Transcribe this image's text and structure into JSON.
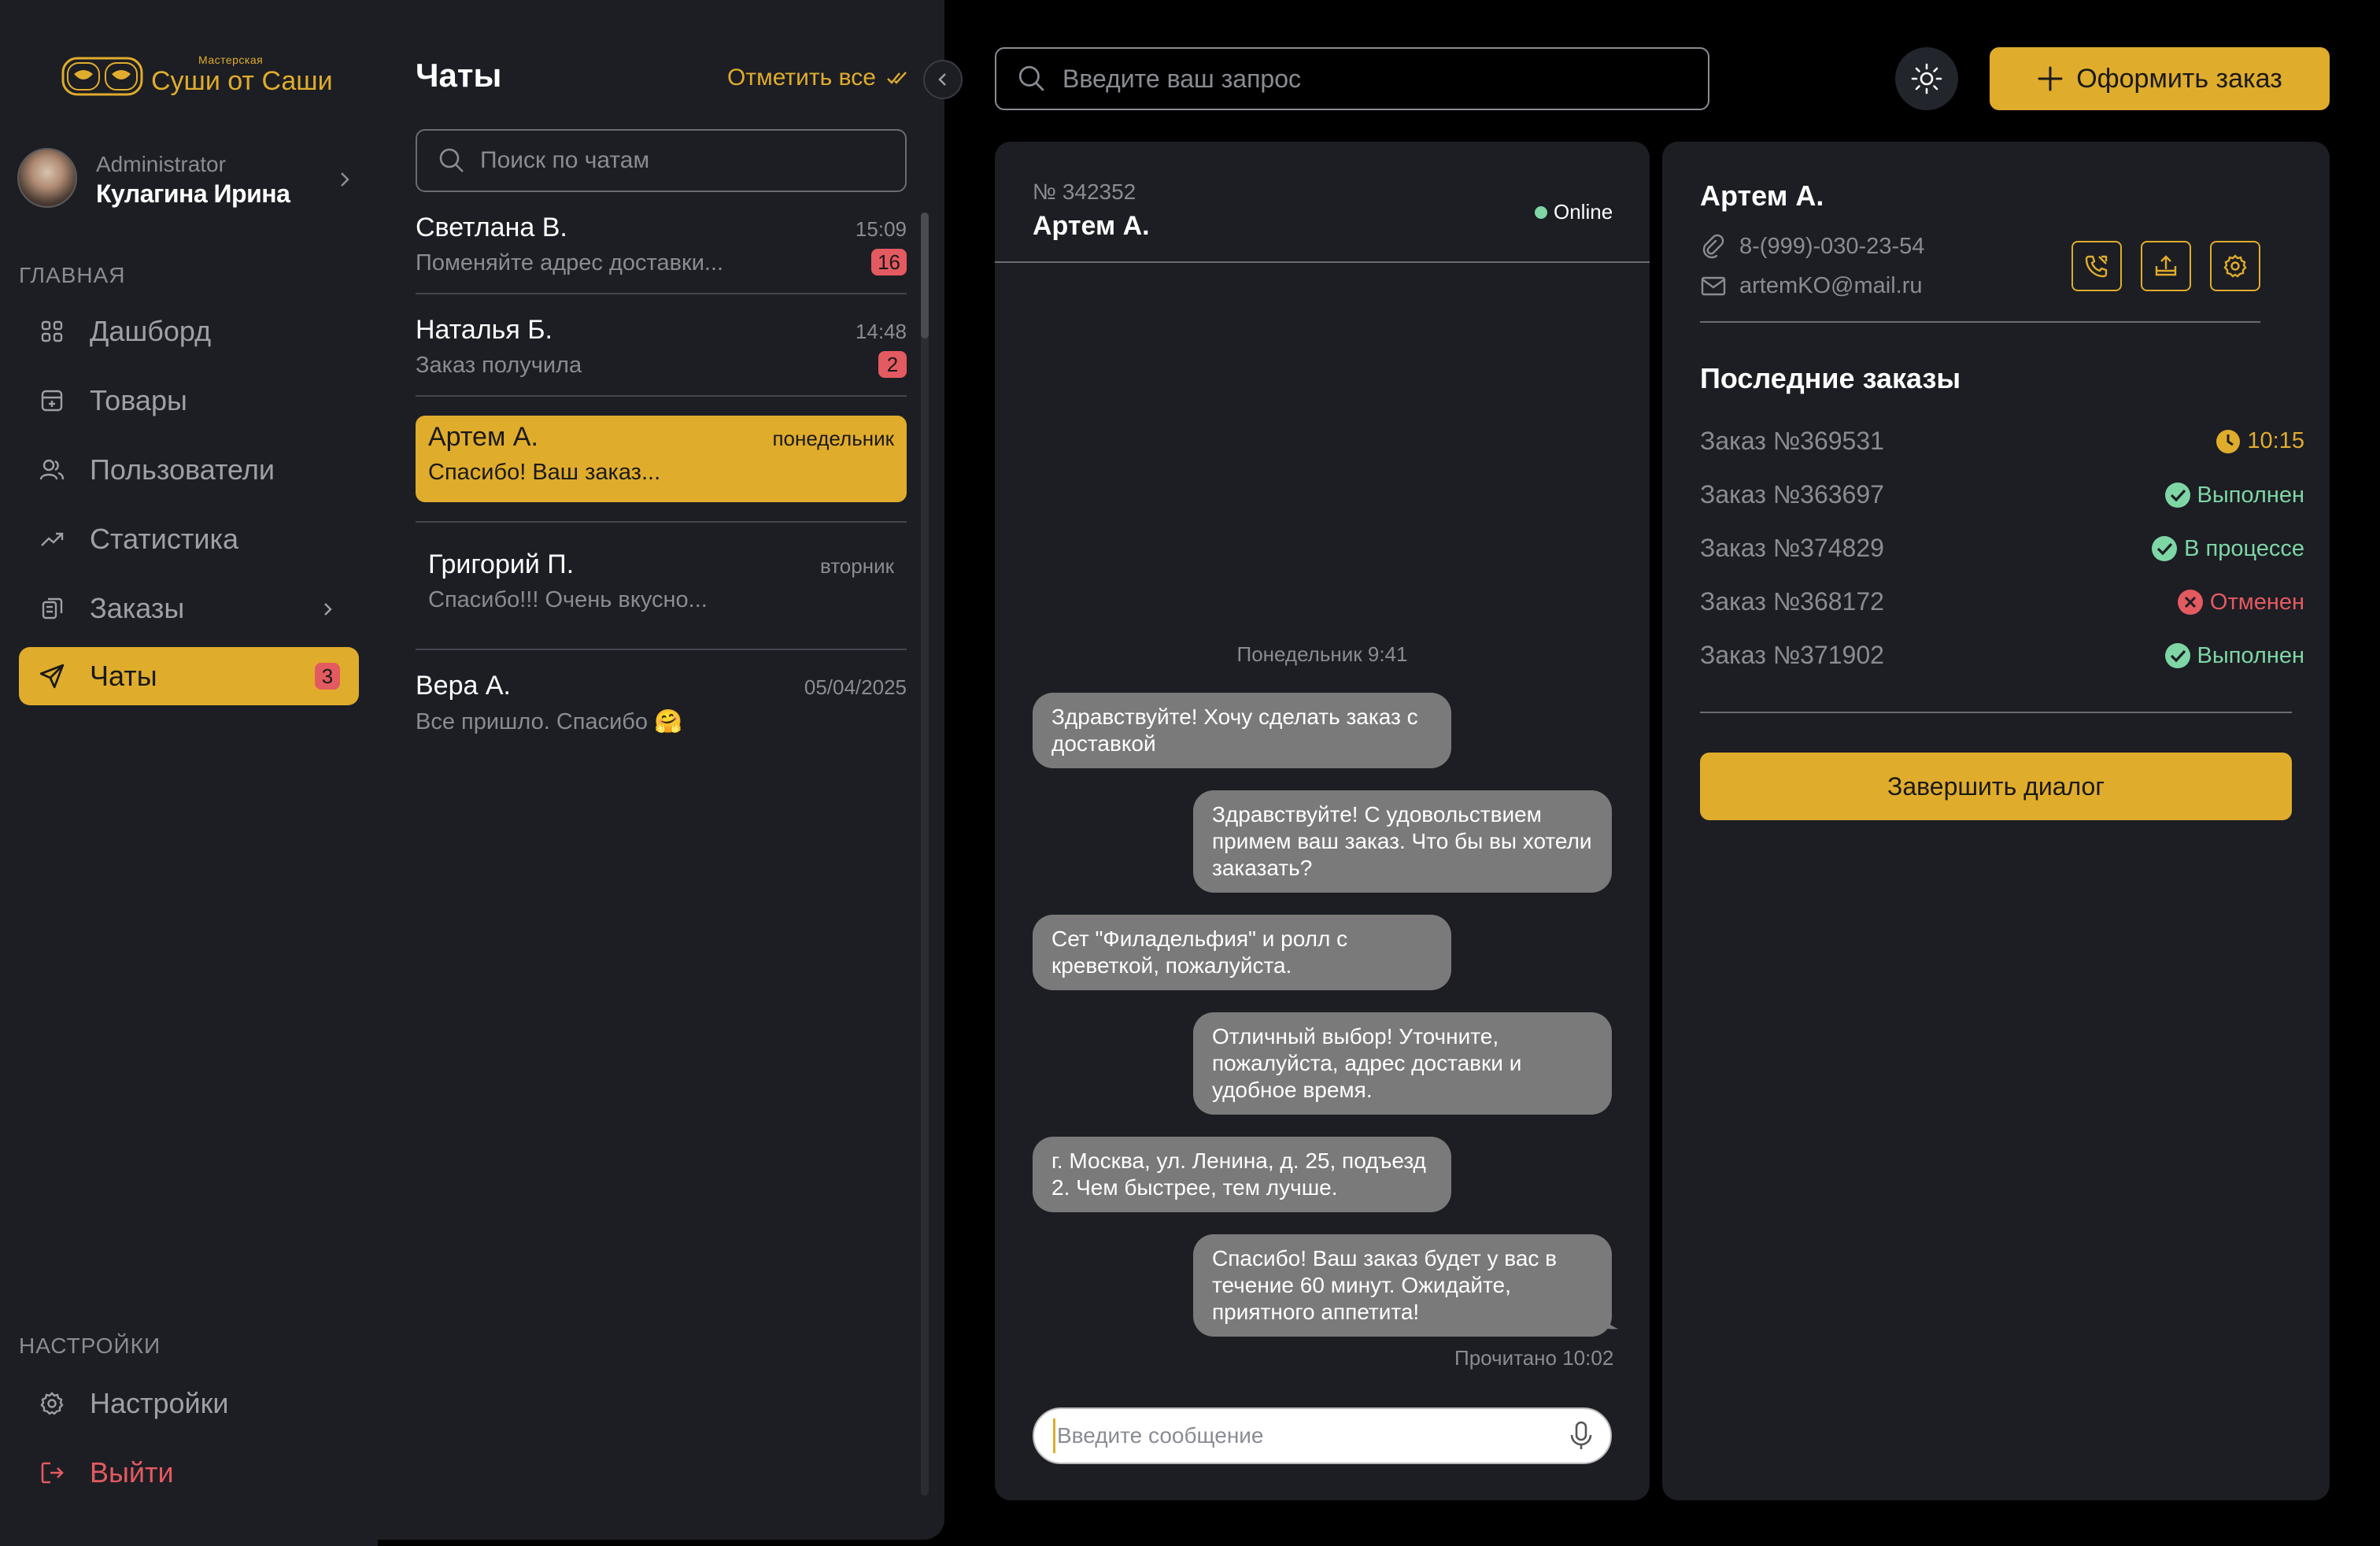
{
  "brand": {
    "subtitle": "Мастерская",
    "name": "Суши от Саши"
  },
  "user": {
    "role": "Administrator",
    "name": "Кулагина Ирина"
  },
  "nav": {
    "main_label": "ГЛАВНАЯ",
    "items": [
      {
        "label": "Дашборд",
        "icon": "dashboard-icon"
      },
      {
        "label": "Товары",
        "icon": "products-icon"
      },
      {
        "label": "Пользователи",
        "icon": "users-icon"
      },
      {
        "label": "Статистика",
        "icon": "stats-icon"
      },
      {
        "label": "Заказы",
        "icon": "orders-icon"
      },
      {
        "label": "Чаты",
        "icon": "send-icon",
        "badge": "3",
        "active": true
      }
    ],
    "settings_label": "НАСТРОЙКИ",
    "settings": "Настройки",
    "logout": "Выйти"
  },
  "chats": {
    "title": "Чаты",
    "mark_all": "Отметить все",
    "search_placeholder": "Поиск по чатам",
    "items": [
      {
        "name": "Светлана В.",
        "time": "15:09",
        "preview": "Поменяйте адрес доставки...",
        "badge": "16"
      },
      {
        "name": "Наталья Б.",
        "time": "14:48",
        "preview": "Заказ получила",
        "badge": "2"
      },
      {
        "name": "Артем А.",
        "time": "понедельник",
        "preview": "Спасибо! Ваш заказ...",
        "active": true
      },
      {
        "name": "Григорий П.",
        "time": "вторник",
        "preview": "Спасибо!!! Очень вкусно..."
      },
      {
        "name": "Вера А.",
        "time": "05/04/2025",
        "preview": "Все пришло. Спасибо 🤗"
      }
    ]
  },
  "topbar": {
    "search_placeholder": "Введите ваш запрос",
    "order_button": "Оформить заказ"
  },
  "conversation": {
    "number": "№ 342352",
    "name": "Артем А.",
    "status": "Online",
    "day_label": "Понедельник 9:41",
    "messages": [
      {
        "from": "client",
        "text": "Здравствуйте! Хочу сделать заказ с доставкой"
      },
      {
        "from": "operator",
        "text": "Здравствуйте! С удовольствием примем ваш заказ. Что бы вы хотели заказать?"
      },
      {
        "from": "client",
        "text": "Сет \"Филадельфия\" и ролл с креветкой, пожалуйста."
      },
      {
        "from": "operator",
        "text": "Отличный выбор! Уточните, пожалуйста, адрес доставки и удобное время."
      },
      {
        "from": "client",
        "text": "г. Москва, ул. Ленина, д. 25, подъезд 2. Чем быстрее, тем лучше."
      },
      {
        "from": "operator",
        "text": "Спасибо! Ваш заказ будет у вас в течение 60 минут. Ожидайте, приятного аппетита!"
      }
    ],
    "read_status": "Прочитано 10:02",
    "input_placeholder": "Введите сообщение"
  },
  "details": {
    "name": "Артем А.",
    "phone": "8-(999)-030-23-54",
    "email": "artemKO@mail.ru",
    "recent_title": "Последние заказы",
    "orders": [
      {
        "name": "Заказ №369531",
        "status": "10:15",
        "kind": "pending",
        "color": "#e0ac2c"
      },
      {
        "name": "Заказ №363697",
        "status": "Выполнен",
        "kind": "done",
        "color": "#7ed6a4"
      },
      {
        "name": "Заказ №374829",
        "status": "В процессе",
        "kind": "done",
        "color": "#7ed6a4"
      },
      {
        "name": "Заказ №368172",
        "status": "Отменен",
        "kind": "cancel",
        "color": "#e35a60"
      },
      {
        "name": "Заказ №371902",
        "status": "Выполнен",
        "kind": "done",
        "color": "#7ed6a4"
      }
    ],
    "finish_button": "Завершить диалог"
  },
  "colors": {
    "accent": "#e0ac2c",
    "danger": "#e35a60",
    "success": "#7ed6a4",
    "panel": "#1c1e24"
  }
}
